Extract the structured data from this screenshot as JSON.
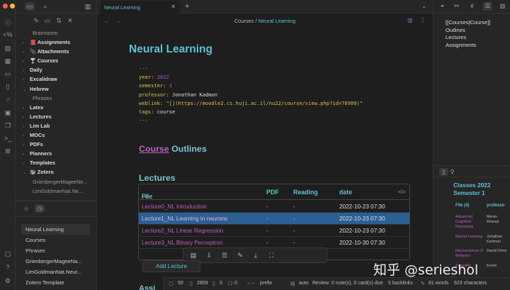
{
  "colors": {
    "accent": "#5fc0d4",
    "link": "#c05fbd",
    "selected_row": "#2c5f93"
  },
  "sidebar": {
    "tree": [
      {
        "label": "Brainstorm",
        "type": "file"
      },
      {
        "label": "Assignments",
        "type": "folder",
        "icon": "📕",
        "collapsed": true
      },
      {
        "label": "Attachments",
        "type": "folder",
        "icon": "📎",
        "collapsed": true
      },
      {
        "label": "Courses",
        "type": "folder",
        "icon": "🍸",
        "collapsed": true
      },
      {
        "label": "Daily",
        "type": "folder",
        "collapsed": true
      },
      {
        "label": "Excalidraw",
        "type": "folder",
        "collapsed": true
      },
      {
        "label": "Hebrew",
        "type": "folder",
        "collapsed": false
      },
      {
        "label": "Phrases",
        "type": "file"
      },
      {
        "label": "Latex",
        "type": "folder",
        "collapsed": true
      },
      {
        "label": "Lectures",
        "type": "folder",
        "collapsed": true
      },
      {
        "label": "Lim Lab",
        "type": "folder",
        "collapsed": true
      },
      {
        "label": "MOCs",
        "type": "folder",
        "collapsed": true
      },
      {
        "label": "PDFs",
        "type": "folder",
        "collapsed": true
      },
      {
        "label": "Planners",
        "type": "folder",
        "collapsed": true
      },
      {
        "label": "Templates",
        "type": "folder",
        "collapsed": true
      },
      {
        "label": "Zotero",
        "type": "folder",
        "icon": "📚",
        "collapsed": false
      },
      {
        "label": "GrienbergerMageeNe...",
        "type": "file"
      },
      {
        "label": "LimGoldmanNat.Ne...",
        "type": "file"
      }
    ],
    "recent": [
      "Neural Learning",
      "Courses",
      "Phrases",
      "GrienbergerMageeNa...",
      "LimGoldmanNat.Neur...",
      "Zotero Template"
    ]
  },
  "tab": {
    "title": "Neural Learning"
  },
  "breadcrumb": {
    "parent": "Courses",
    "sep": "/",
    "current": "Neural Learning"
  },
  "note": {
    "title": "Neural Learning",
    "frontmatter": {
      "dash": "---",
      "year_key": "year:",
      "year_val": "2022",
      "semester_key": "semester:",
      "semester_val": "1",
      "professor_key": "professor:",
      "professor_val": "Jonathan Kadmon",
      "weblink_key": "weblink:",
      "weblink_val": "\"[](https://moodle2.cs.huji.ac.il/nu22/course/view.php?id=76909)\"",
      "tags_key": "tags:",
      "tags_val": "course"
    },
    "h_outlines_link": "Course",
    "h_outlines_rest": " Outlines",
    "h_lectures": "Lectures",
    "h_cut": "Assi"
  },
  "dataview": {
    "columns": {
      "file": "File",
      "count": "(4)",
      "pdf": "PDF",
      "reading": "Reading",
      "date": "date"
    },
    "code_icon": "</>",
    "rows": [
      {
        "file": "Lecture0_NL Introduction",
        "pdf": "-",
        "reading": "-",
        "date": "2022-10-23 07:30",
        "selected": false
      },
      {
        "file": "Lecture1_NL Learning in neurons",
        "pdf": "-",
        "reading": "-",
        "date": "2022-10-23 07:30",
        "selected": true
      },
      {
        "file": "Lecture2_NL Linear Regression",
        "pdf": "-",
        "reading": "-",
        "date": "2022-10-23 07:30",
        "selected": false
      },
      {
        "file": "Lecture3_NL Binary Perceptron",
        "pdf": "-",
        "reading": "-",
        "date": "2022-10-30 07:30",
        "selected": false
      }
    ]
  },
  "add_lecture": "Add Lecture",
  "outline": [
    "[[Courses|Course]]",
    "Outlines",
    "Lectures",
    "Assignments"
  ],
  "classes": {
    "title1": "Classes 2022",
    "title2": "Semester 1",
    "col1": "File (4)",
    "col2": "professo",
    "rows": [
      {
        "file": "Advanced Cognitive Processes",
        "prof": "Merav Ahissar"
      },
      {
        "file": "Neural Learning",
        "prof": "Jonathan Kadmon"
      },
      {
        "file": "Neuroscience of Behavior",
        "prof": "David Omer"
      },
      {
        "file": "Scientific",
        "prof": "Keren"
      }
    ]
  },
  "status": {
    "s1": "50",
    "s2": "2859",
    "s3": "0",
    "s4": "0",
    "prefix": "prefix",
    "auto": "auto",
    "review": "Review: 0 note(s), 0 card(s) due",
    "backlinks": "5 backlinks",
    "words": "81 words",
    "chars": "623 characters"
  },
  "watermark": "知乎 @serieshol"
}
